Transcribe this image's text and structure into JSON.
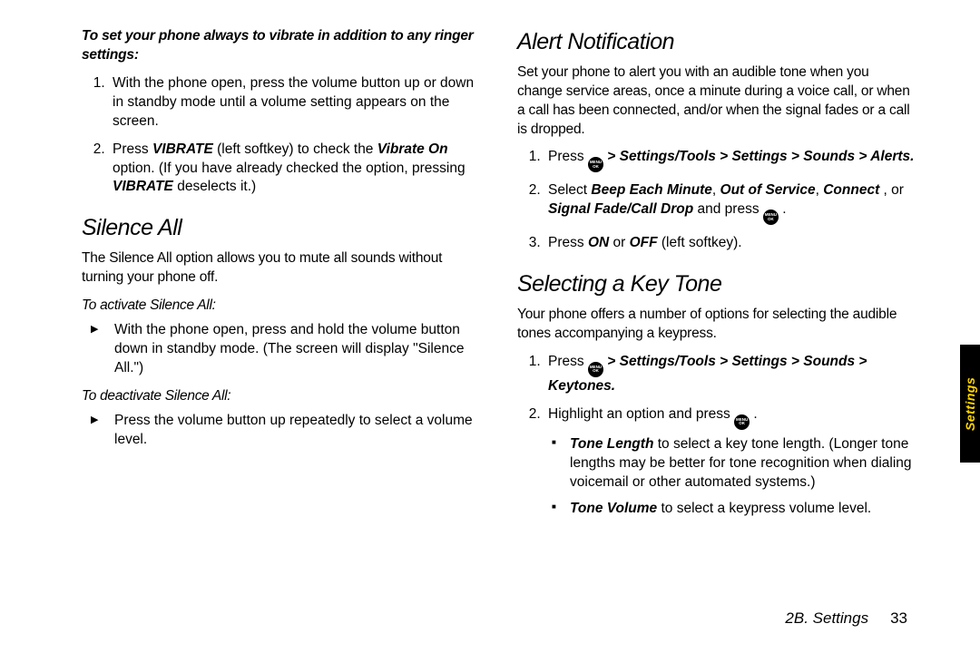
{
  "left": {
    "intro": "To set your phone always to vibrate in addition to any ringer settings:",
    "step1": "With the phone open, press the volume button up or down in standby mode until a volume setting appears on the screen.",
    "step2_a": "Press ",
    "step2_b": "VIBRATE",
    "step2_c": " (left softkey) to check the ",
    "step2_d": "Vibrate On",
    "step2_e": " option. (If you have already checked the option, pressing ",
    "step2_f": "VIBRATE",
    "step2_g": " deselects it.)",
    "h_silence": "Silence All",
    "silence_p": "The Silence All option allows you to mute all sounds without turning your phone off.",
    "activate_h": "To activate Silence All:",
    "activate_li": "With the phone open, press and hold the volume button down in standby mode. (The screen will display \"Silence All.\")",
    "deactivate_h": "To deactivate Silence All:",
    "deactivate_li": "Press the volume button up repeatedly to select a volume level."
  },
  "right": {
    "h_alert": "Alert Notification",
    "alert_p": "Set your phone to alert you with an audible tone when you change service areas, once a minute during a voice call, or when a call has been connected, and/or when the signal fades or a call is dropped.",
    "a1_a": "Press ",
    "a1_b": " > Settings/Tools > Settings > Sounds > Alerts.",
    "a2_a": "Select ",
    "a2_b": "Beep Each Minute",
    "a2_c": ", ",
    "a2_d": "Out of Service",
    "a2_e": ", ",
    "a2_f": "Connect",
    "a2_g": " , or ",
    "a2_h": "Signal Fade/Call Drop",
    "a2_i": " and press ",
    "a2_j": " .",
    "a3_a": "Press ",
    "a3_b": "ON",
    "a3_c": " or ",
    "a3_d": "OFF",
    "a3_e": " (left softkey).",
    "h_keytone": "Selecting a Key Tone",
    "keytone_p": "Your phone offers a number of options for selecting the audible tones accompanying a keypress.",
    "k1_a": "Press ",
    "k1_b": " > Settings/Tools > Settings > Sounds > Keytones.",
    "k2_a": "Highlight an option and press ",
    "k2_b": " .",
    "k2s1_a": "Tone Length",
    "k2s1_b": " to select a key tone length. (Longer tone lengths may be better for tone recognition when dialing voicemail or other automated systems.)",
    "k2s2_a": "Tone Volume",
    "k2s2_b": " to select a keypress volume level."
  },
  "footer": {
    "section": "2B. Settings",
    "page": "33"
  },
  "tab": "Settings",
  "icon": {
    "l1": "MENU",
    "l2": "OK"
  }
}
